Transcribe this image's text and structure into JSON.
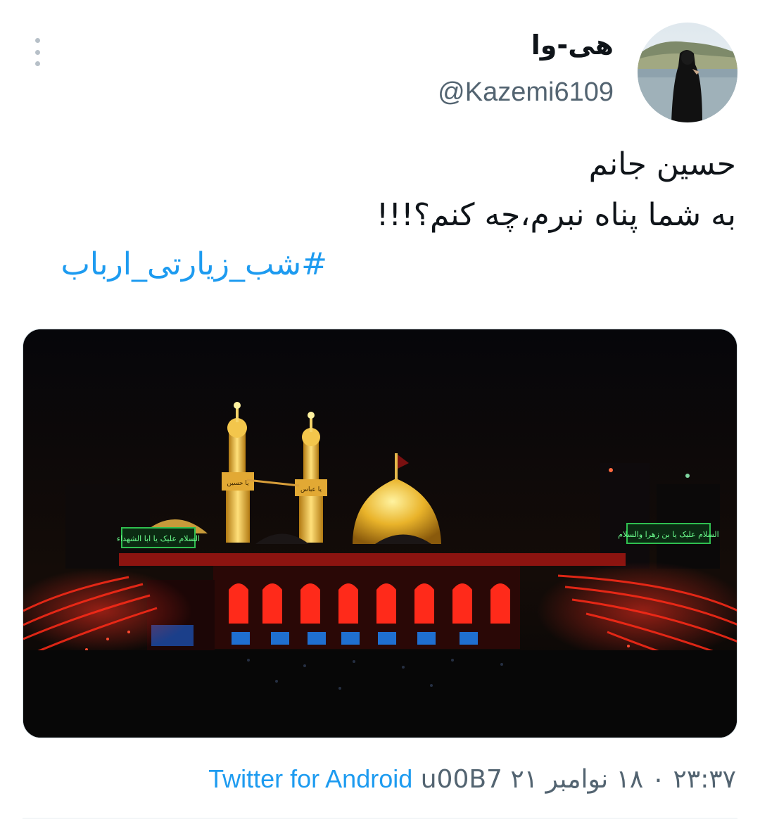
{
  "tweet": {
    "author": {
      "display_name": "هی-وا",
      "handle": "@Kazemi6109",
      "avatar_icon": "avatar-woman-by-lake"
    },
    "text_lines": [
      "حسین جانم",
      "به شما پناه نبرم،چه کنم؟!!!"
    ],
    "hashtag": "شب_زیارتی_ارباب#",
    "media": {
      "banner_left": "السلام علیک یا ابا الشهداء",
      "banner_right": "السلام علیک یا بن زهرا والسلام",
      "minaret_left_label": "یا حسین",
      "minaret_right_label": "یا عباس"
    },
    "meta": {
      "time": "۲۳:۳۷ ۰ ۱۸ نوامبر ۲۱",
      "separator": "u00B7",
      "source": "Twitter for Android"
    }
  },
  "colors": {
    "link": "#1d9bf0",
    "secondary_text": "#536471",
    "primary_text": "#0f1419"
  },
  "icons": {
    "more": "more-vertical-icon"
  }
}
